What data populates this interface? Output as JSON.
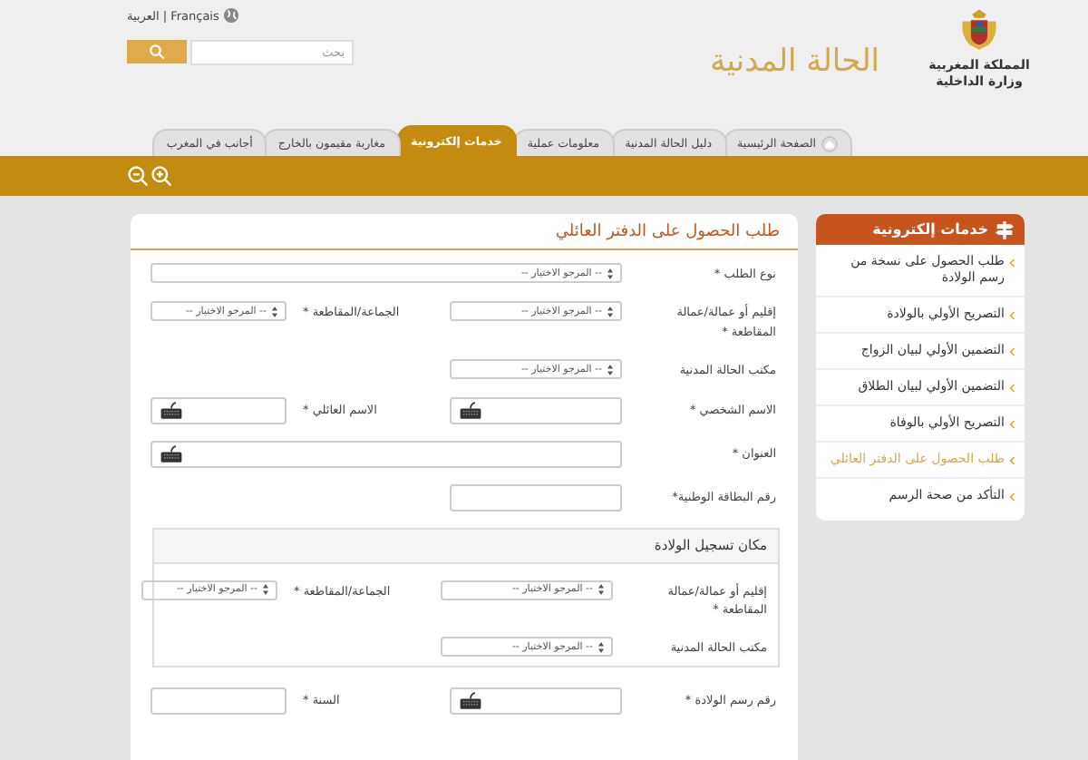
{
  "header": {
    "lang_links": "العربية | Français",
    "search": {
      "placeholder": "بحث"
    },
    "site_title": "الحالة المدنية",
    "ministry": [
      "المملكة المغربية",
      "وزارة الداخلية"
    ]
  },
  "tabs": [
    {
      "label": "الصفحة الرئيسية",
      "selected": false,
      "kind": "home"
    },
    {
      "label": "دليل الحالة المدنية",
      "selected": false,
      "kind": "plain"
    },
    {
      "label": "معلومات عملية",
      "selected": false,
      "kind": "plain"
    },
    {
      "label": "خدمات إلكترونية",
      "selected": true,
      "kind": "plain"
    },
    {
      "label": "مغاربة مقيمون بالخارج",
      "selected": false,
      "kind": "plain"
    },
    {
      "label": "أجانب في المغرب",
      "selected": false,
      "kind": "plain"
    }
  ],
  "sidebar": {
    "title": "خدمات إلكترونية",
    "items": [
      {
        "label": "طلب الحصول على نسخة من رسم الولادة",
        "selected": false
      },
      {
        "label": "التصريح الأولي بالولادة",
        "selected": false
      },
      {
        "label": "التضمين الأولي لبيان الزواج",
        "selected": false
      },
      {
        "label": "التضمين الأولي لبيان الطلاق",
        "selected": false
      },
      {
        "label": "التصريح الأولي بالوفاة",
        "selected": false
      },
      {
        "label": "طلب الحصول على الدفتر العائلي",
        "selected": true
      },
      {
        "label": "التأكد من صحة الرسم",
        "selected": false
      }
    ]
  },
  "form": {
    "title": "طلب الحصول على الدفتر العائلي",
    "blocks": [
      {
        "kind": "row",
        "label": "نوع الطلب *",
        "fields": [
          {
            "kind": "select-wide",
            "value": "-- المرجو الاختيار --"
          }
        ]
      },
      {
        "kind": "row",
        "label": "إقليم أو عمالة/عمالة المقاطعة *",
        "fields": [
          {
            "kind": "select",
            "value": "-- المرجو الاختيار --"
          },
          {
            "kind": "select",
            "label": "الجماعة/المقاطعة *",
            "value": "-- المرجو الاختيار --"
          }
        ]
      },
      {
        "kind": "row",
        "label": "مكتب الحالة المدنية",
        "fields": [
          {
            "kind": "select",
            "value": "-- المرجو الاختيار --"
          }
        ]
      },
      {
        "kind": "row",
        "label": "الاسم الشخصي *",
        "fields": [
          {
            "kind": "keyboard"
          },
          {
            "kind": "keyboard",
            "label": "الاسم العائلي *"
          }
        ]
      },
      {
        "kind": "row",
        "label": "العنوان *",
        "fields": [
          {
            "kind": "keyboard-wide"
          }
        ]
      },
      {
        "kind": "row",
        "label": "رقم البطاقة الوطنية*",
        "fields": [
          {
            "kind": "text"
          }
        ]
      },
      {
        "kind": "fieldset",
        "legend": "مكان تسجيل الولادة",
        "rows": [
          {
            "label": "إقليم أو عمالة/عمالة المقاطعة *",
            "fields": [
              {
                "kind": "select",
                "value": "-- المرجو الاختيار --"
              },
              {
                "kind": "select",
                "label": "الجماعة/المقاطعة *",
                "value": "-- المرجو الاختيار --"
              }
            ]
          },
          {
            "label": "مكتب الحالة المدنية",
            "fields": [
              {
                "kind": "select",
                "value": "-- المرجو الاختيار --"
              }
            ]
          }
        ]
      },
      {
        "kind": "row",
        "label": "رقم رسم الولادة *",
        "fields": [
          {
            "kind": "keyboard"
          },
          {
            "kind": "text",
            "label": "السنة *"
          }
        ]
      }
    ]
  }
}
